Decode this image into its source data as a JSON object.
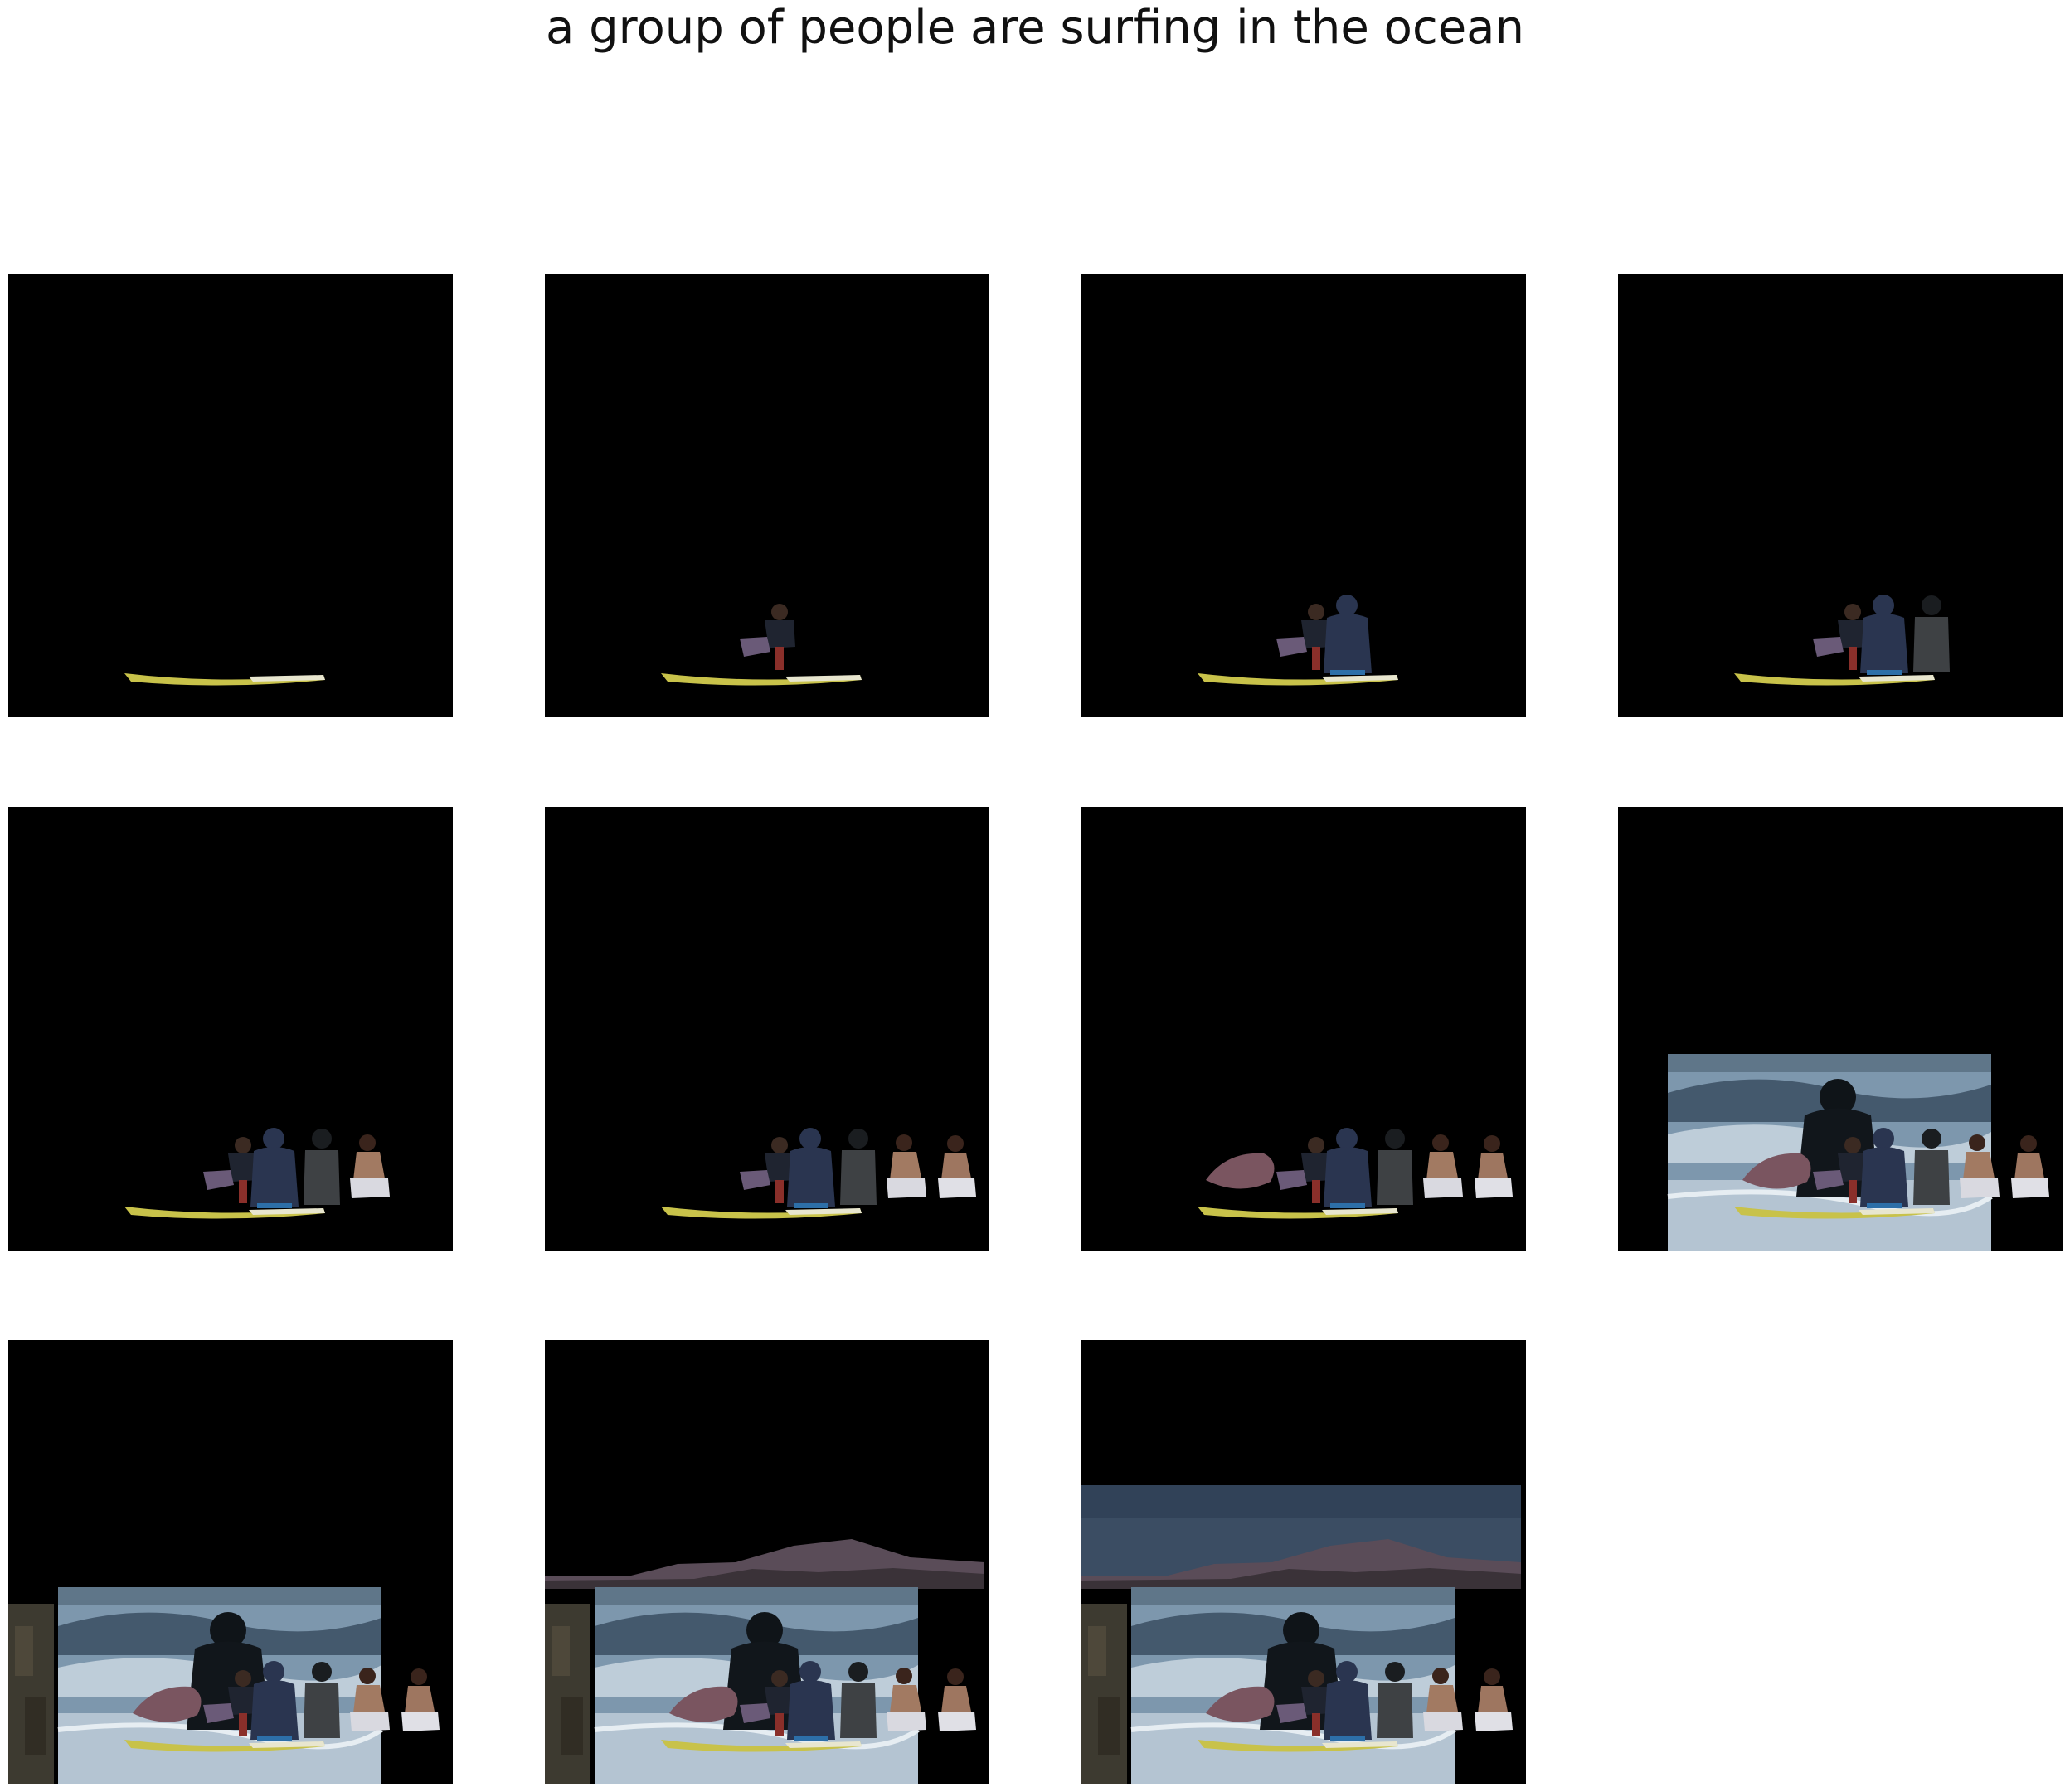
{
  "figure": {
    "title": "a group of people are surfing in the ocean",
    "panel_count": 11,
    "columns": 4,
    "panel_background": "#000000",
    "layers": [
      "surfboard",
      "person-crouching",
      "person-hooded",
      "person-dark",
      "person-shirtless",
      "person-shirtless-2",
      "surfboard-pink",
      "ocean-wave",
      "rock",
      "mountain",
      "sky"
    ],
    "panels": [
      {
        "step": 1,
        "layers": 1
      },
      {
        "step": 2,
        "layers": 2
      },
      {
        "step": 3,
        "layers": 3
      },
      {
        "step": 4,
        "layers": 4
      },
      {
        "step": 5,
        "layers": 5
      },
      {
        "step": 6,
        "layers": 6
      },
      {
        "step": 7,
        "layers": 7
      },
      {
        "step": 8,
        "layers": 8
      },
      {
        "step": 9,
        "layers": 9
      },
      {
        "step": 10,
        "layers": 10
      },
      {
        "step": 11,
        "layers": 11
      }
    ],
    "colors": {
      "surfboard": "#c8c24a",
      "hood": "#2a3550",
      "ocean": "#7d97ad",
      "foam": "#c9d6e0",
      "sky": "#3b4d63",
      "mountain": "#5a4c58"
    }
  }
}
